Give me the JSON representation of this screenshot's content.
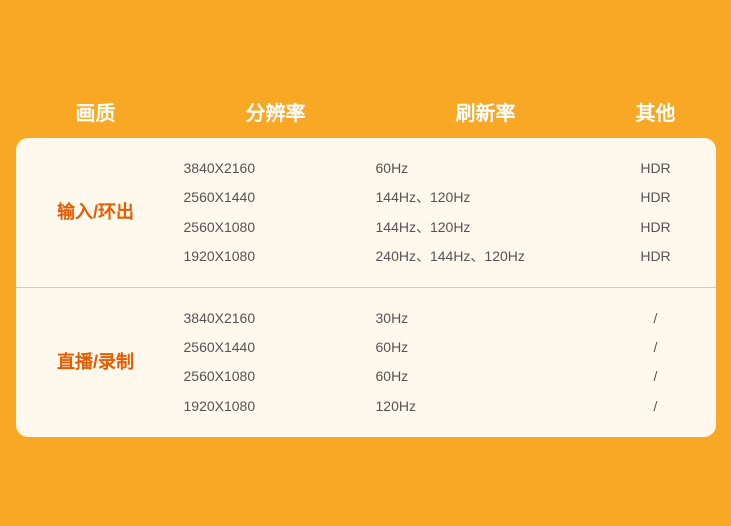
{
  "header": {
    "col1": "画质",
    "col2": "分辨率",
    "col3": "刷新率",
    "col4": "其他"
  },
  "rows": [
    {
      "label": "输入/环出",
      "resolutions": [
        "3840X2160",
        "2560X1440",
        "2560X1080",
        "1920X1080"
      ],
      "refresh": [
        "60Hz",
        "144Hz、120Hz",
        "144Hz、120Hz",
        "240Hz、144Hz、120Hz"
      ],
      "other": [
        "HDR",
        "HDR",
        "HDR",
        "HDR"
      ]
    },
    {
      "label": "直播/录制",
      "resolutions": [
        "3840X2160",
        "2560X1440",
        "2560X1080",
        "1920X1080"
      ],
      "refresh": [
        "30Hz",
        "60Hz",
        "60Hz",
        "120Hz"
      ],
      "other": [
        "/",
        "/",
        "/",
        "/"
      ]
    }
  ]
}
